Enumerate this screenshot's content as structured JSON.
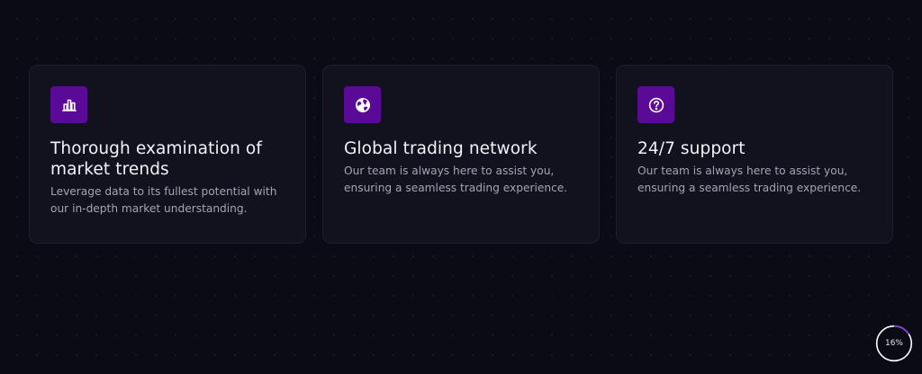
{
  "features": [
    {
      "icon": "bar-chart-icon",
      "title": "Thorough examination of market trends",
      "description": "Leverage data to its fullest potential with our in-depth market understanding."
    },
    {
      "icon": "globe-icon",
      "title": "Global trading network",
      "description": "Our team is always here to assist you, ensuring a seamless trading experience."
    },
    {
      "icon": "question-circle-icon",
      "title": "24/7 support",
      "description": "Our team is always here to assist you, ensuring a seamless trading experience."
    }
  ],
  "scroll_progress": {
    "label": "16%",
    "value": 0.16
  },
  "colors": {
    "background": "#0b0b15",
    "card": "#12121e",
    "accent": "#5a0a96"
  }
}
